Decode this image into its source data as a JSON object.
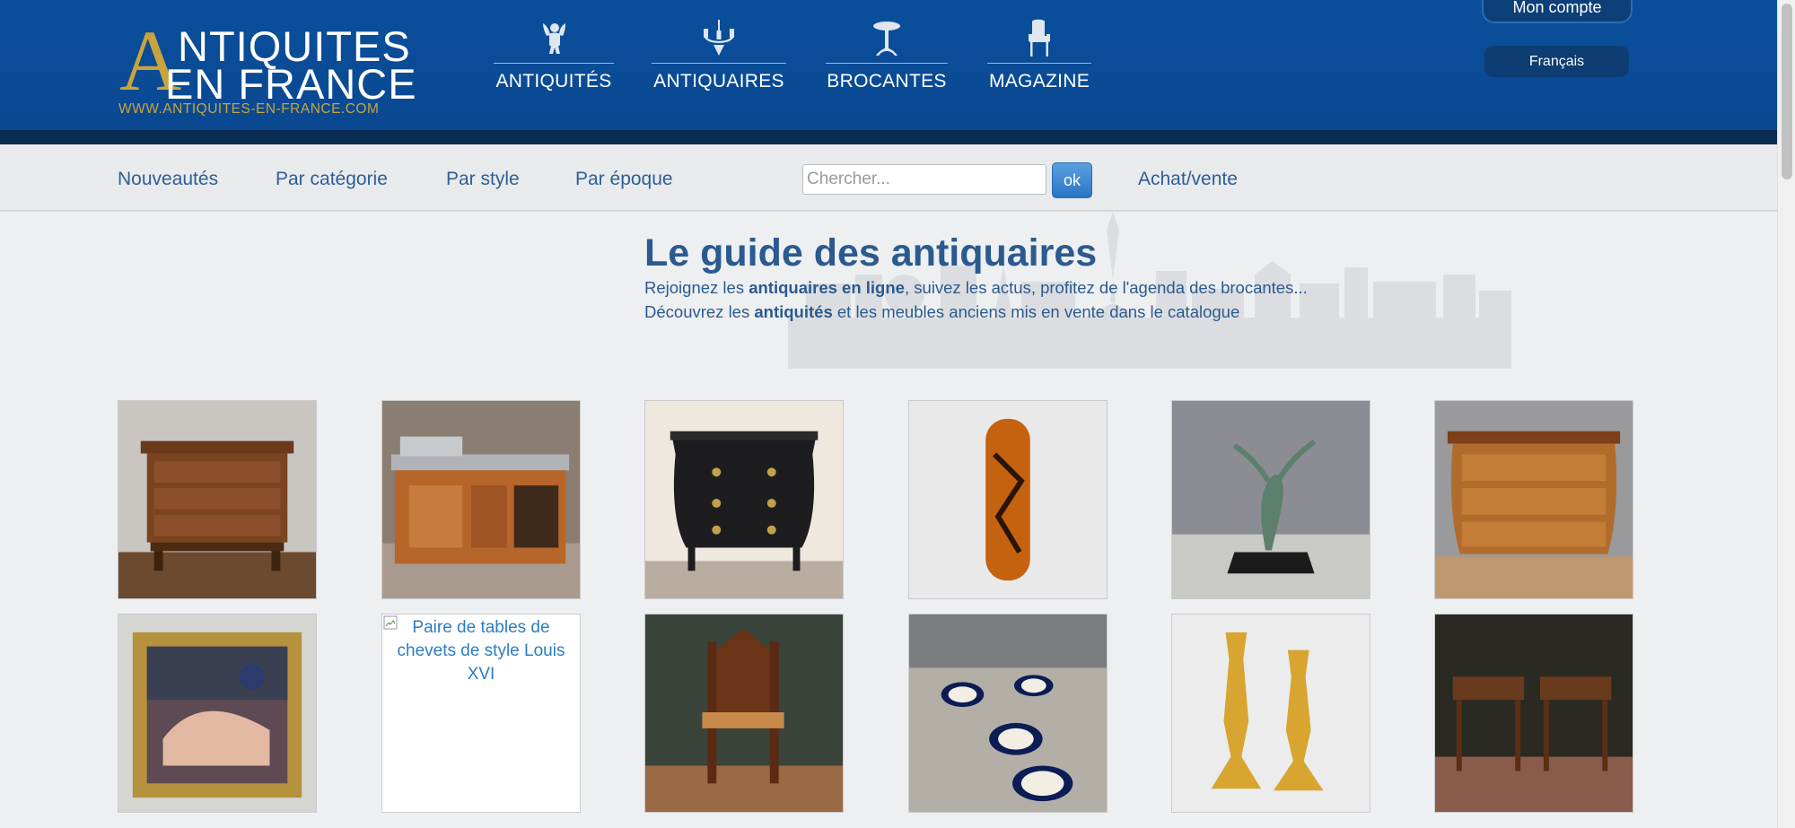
{
  "header": {
    "logo": {
      "big_letter": "A",
      "line1": "NTIQUITES",
      "line2": "EN FRANCE",
      "url": "WWW.ANTIQUITES-EN-FRANCE.COM"
    },
    "nav": [
      {
        "label": "ANTIQUITÉS",
        "icon": "cherub-icon"
      },
      {
        "label": "ANTIQUAIRES",
        "icon": "chandelier-icon"
      },
      {
        "label": "BROCANTES",
        "icon": "pedestal-table-icon"
      },
      {
        "label": "MAGAZINE",
        "icon": "armchair-icon"
      }
    ],
    "account_label": "Mon compte",
    "language_label": "Français"
  },
  "subnav": {
    "links": [
      "Nouveautés",
      "Par catégorie",
      "Par style",
      "Par époque"
    ],
    "search_placeholder": "Chercher...",
    "search_button": "ok",
    "buy_sell": "Achat/vente"
  },
  "intro": {
    "title": "Le guide des antiquaires",
    "line1_pre": "Rejoignez les ",
    "line1_bold": "antiquaires en ligne",
    "line1_post": ", suivez les actus, profitez de l'agenda des brocantes...",
    "line2_pre": "Découvrez les ",
    "line2_bold": "antiquités",
    "line2_post": " et les meubles anciens mis en vente dans le catalogue"
  },
  "products": [
    {
      "image": "small-empire-chest-of-drawers"
    },
    {
      "image": "zinc-bar-counter"
    },
    {
      "image": "black-bombe-commode"
    },
    {
      "image": "lacquered-glasses-case"
    },
    {
      "image": "bronze-dancer-sculpture"
    },
    {
      "image": "marquetry-commode"
    },
    {
      "image": "framed-nude-painting"
    },
    {
      "image": "broken-image",
      "alt": "Paire de tables de chevets de style Louis XVI"
    },
    {
      "image": "gothic-chair"
    },
    {
      "image": "porcelain-plates-on-marble"
    },
    {
      "image": "pair-of-brass-candlesticks"
    },
    {
      "image": "pair-of-side-tables"
    }
  ],
  "colors": {
    "header_blue": "#0a4f9b",
    "header_dark": "#0b2d52",
    "gold": "#c9a43e",
    "link_blue": "#2d5f95"
  }
}
